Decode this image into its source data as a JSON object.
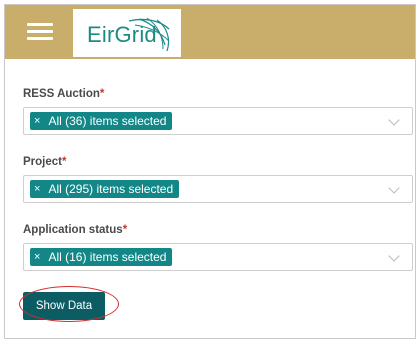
{
  "header": {
    "logo_text": "EirGrid",
    "menu_icon": "hamburger-menu-icon",
    "background": "#c8ae6a"
  },
  "fields": [
    {
      "label": "RESS Auction",
      "required": "*",
      "chip": "All (36) items selected"
    },
    {
      "label": "Project",
      "required": "*",
      "chip": "All (295) items selected"
    },
    {
      "label": "Application status",
      "required": "*",
      "chip": "All (16) items selected"
    }
  ],
  "chip_remove": "×",
  "button": {
    "label": "Show Data",
    "color": "#0c5c63"
  },
  "annotation_color": "#d62c2c"
}
